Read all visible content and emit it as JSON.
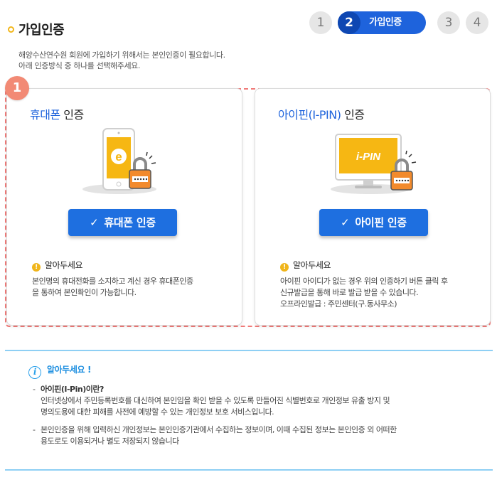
{
  "header": {
    "title": "가입인증",
    "steps": [
      {
        "num": "1",
        "active": false
      },
      {
        "num": "2",
        "active": true,
        "label": "가입인증"
      },
      {
        "num": "3",
        "active": false
      },
      {
        "num": "4",
        "active": false
      }
    ]
  },
  "intro": {
    "line1": "해양수산연수원 회원에 가입하기 위해서는 본인인증이 필요합니다.",
    "line2": "아래 인증방식 중 하나를 선택해주세요."
  },
  "marker": "1",
  "phone_card": {
    "title_highlight": "휴대폰",
    "title_rest": " 인증",
    "illustration_letter": "e",
    "button_check": "✓",
    "button_label": "휴대폰 인증",
    "notice_icon": "!",
    "notice_title": "알아두세요",
    "notice_line1": "본인명의 휴대전화를 소지하고 계신 경우 휴대폰인증",
    "notice_line2": "을 통하여 본인확인이 가능합니다."
  },
  "ipin_card": {
    "title_highlight": "아이핀(I-PIN)",
    "title_rest": " 인증",
    "illustration_text": "i-PIN",
    "button_check": "✓",
    "button_label": "아이핀 인증",
    "notice_icon": "!",
    "notice_title": "알아두세요",
    "notice_line1": "아이핀 아이디가 없는 경우 위의 인증하기 버튼 클릭 후",
    "notice_line2": "신규발급을 통해 바로 발급 받을 수 있습니다.",
    "notice_line3": "오프라인발급 : 주민센터(구.동사무소)"
  },
  "info": {
    "icon": "i",
    "title": "알아두세요 !",
    "dash": "-",
    "item1_term": "아이핀(I-Pin)이란?",
    "item1_line1": "인터넷상에서 주민등록번호를 대신하여 본인임을 확인 받을 수 있도록 만들어진 식별번호로 개인정보 유출 방지 및",
    "item1_line2": "명의도용에 대한 피해를 사전에 예방할 수 있는 개인정보 보호 서비스입니다.",
    "item2_line1": "본인인증을 위해 입력하신 개인정보는 본인인증기관에서 수집하는 정보이며, 이때 수집된 정보는 본인인증 외 어떠한",
    "item2_line2": "용도로도 이용되거나 별도 저장되지 않습니다"
  },
  "colors": {
    "accent_blue": "#1e63dc",
    "button_blue": "#1e6fe0",
    "warning_yellow": "#f0b51b",
    "dashed_red": "#f07a78",
    "info_blue": "#1e8fe0"
  }
}
